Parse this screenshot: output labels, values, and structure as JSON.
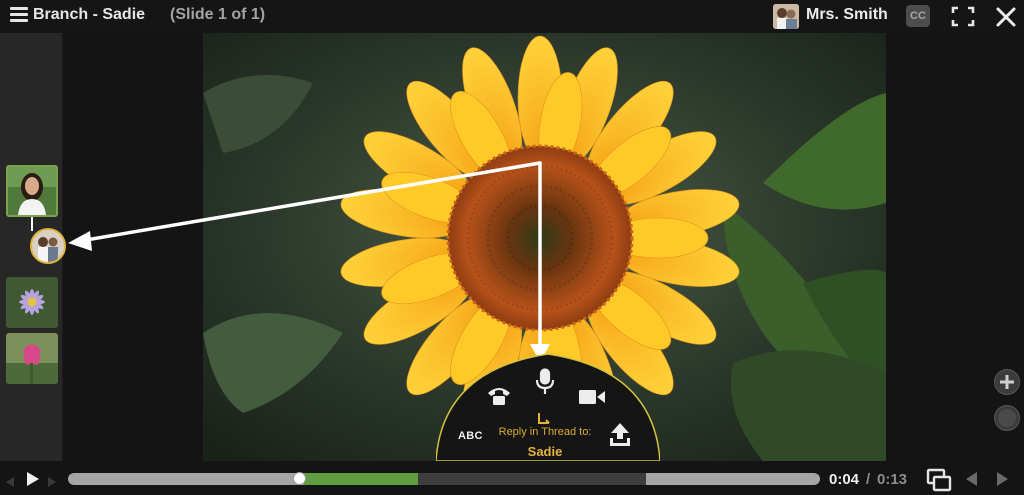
{
  "header": {
    "title": "Branch - Sadie",
    "slide_info": "(Slide 1 of 1)",
    "user_name": "Mrs. Smith",
    "cc_label": "CC"
  },
  "comment_panel": {
    "abc_label": "ABC",
    "reply_label": "Reply in Thread to:",
    "reply_name": "Sadie"
  },
  "playback": {
    "current_time": "0:04",
    "separator": "/",
    "total_time": "0:13",
    "progress_fraction": 0.3077
  },
  "icons": {
    "menu": "hamburger-icon",
    "cc": "closed-captions-icon",
    "fullscreen": "fullscreen-icon",
    "close": "close-icon",
    "phone": "phone-icon",
    "mic": "microphone-icon",
    "video": "video-camera-icon",
    "upload": "upload-icon",
    "play": "play-icon",
    "pip": "picture-in-picture-icon"
  },
  "colors": {
    "accent_gold": "#e3b43a",
    "progress_green": "#5f9e3f",
    "background": "#141414"
  }
}
